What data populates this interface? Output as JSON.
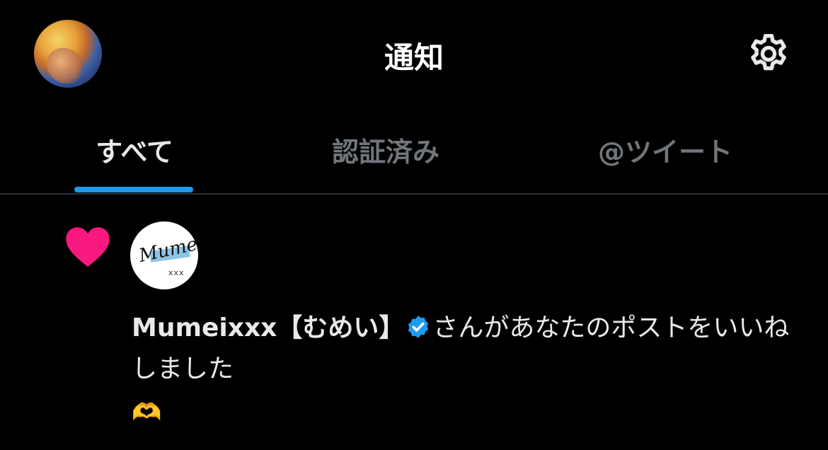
{
  "header": {
    "title": "通知"
  },
  "tabs": [
    {
      "label": "すべて",
      "active": true
    },
    {
      "label": "認証済み",
      "active": false
    },
    {
      "label": "@ツイート",
      "active": false
    }
  ],
  "notification": {
    "type_icon": "heart-icon",
    "user_name": "Mumeixxx【むめい】",
    "verified": true,
    "action_text": "さんがあなたのポストをいいねしました",
    "reply_text": "🫶",
    "avatar_logo": "Mumei",
    "avatar_logo_sub": "xxx"
  },
  "colors": {
    "accent": "#1d9bf0",
    "like": "#f91880",
    "background": "#000000"
  }
}
